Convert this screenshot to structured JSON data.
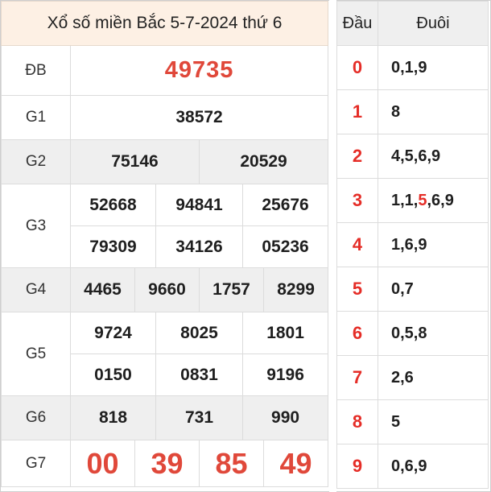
{
  "title": "Xổ số miền Bắc 5-7-2024 thứ 6",
  "labels": {
    "db": "ĐB",
    "g1": "G1",
    "g2": "G2",
    "g3": "G3",
    "g4": "G4",
    "g5": "G5",
    "g6": "G6",
    "g7": "G7"
  },
  "prizes": {
    "db": "49735",
    "g1": "38572",
    "g2": [
      "75146",
      "20529"
    ],
    "g3": [
      "52668",
      "94841",
      "25676",
      "79309",
      "34126",
      "05236"
    ],
    "g4": [
      "4465",
      "9660",
      "1757",
      "8299"
    ],
    "g5": [
      "9724",
      "8025",
      "1801",
      "0150",
      "0831",
      "9196"
    ],
    "g6": [
      "818",
      "731",
      "990"
    ],
    "g7": [
      "00",
      "39",
      "85",
      "49"
    ]
  },
  "loto": {
    "head_label": "Đầu",
    "tail_label": "Đuôi",
    "rows": [
      {
        "head": "0",
        "tail": "0,1,9"
      },
      {
        "head": "1",
        "tail": "8"
      },
      {
        "head": "2",
        "tail": "4,5,6,9"
      },
      {
        "head": "3",
        "tail_before": "1,1,",
        "tail_highlight": "5",
        "tail_after": ",6,9"
      },
      {
        "head": "4",
        "tail": "1,6,9"
      },
      {
        "head": "5",
        "tail": "0,7"
      },
      {
        "head": "6",
        "tail": "0,5,8"
      },
      {
        "head": "7",
        "tail": "2,6"
      },
      {
        "head": "8",
        "tail": "5"
      },
      {
        "head": "9",
        "tail": "0,6,9"
      }
    ]
  },
  "colors": {
    "highlight_red": "#e0483a",
    "title_bg": "#fdf0e4",
    "row_gray": "#efefef"
  }
}
